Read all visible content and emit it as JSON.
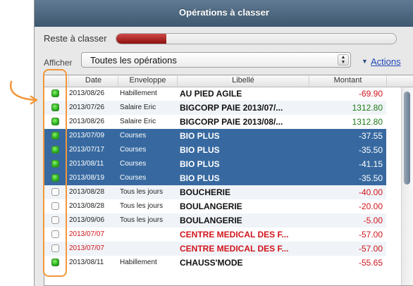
{
  "window": {
    "title": "Opérations à classer"
  },
  "toolbar": {
    "reste_label": "Reste à classer",
    "progress_fraction": 0.18,
    "afficher_label": "Afficher",
    "filter_value": "Toutes les opérations",
    "actions_label": "Actions"
  },
  "table": {
    "headers": {
      "date": "Date",
      "enveloppe": "Enveloppe",
      "libelle": "Libellé",
      "montant": "Montant"
    },
    "rows": [
      {
        "checked": true,
        "date": "2013/08/26",
        "enveloppe": "Habillement",
        "libelle": "AU PIED AGILE",
        "montant": "-69.90",
        "selected": false,
        "red": false
      },
      {
        "checked": true,
        "date": "2013/07/26",
        "enveloppe": "Salaire Eric",
        "libelle": "BIGCORP PAIE 2013/07/...",
        "montant": "1312.80",
        "selected": false,
        "red": false
      },
      {
        "checked": true,
        "date": "2013/08/26",
        "enveloppe": "Salaire Eric",
        "libelle": "BIGCORP PAIE 2013/08/...",
        "montant": "1312.80",
        "selected": false,
        "red": false
      },
      {
        "checked": true,
        "date": "2013/07/09",
        "enveloppe": "Courses",
        "libelle": "BIO PLUS",
        "montant": "-37.55",
        "selected": true,
        "red": false
      },
      {
        "checked": true,
        "date": "2013/07/17",
        "enveloppe": "Courses",
        "libelle": "BIO PLUS",
        "montant": "-35.50",
        "selected": true,
        "red": false
      },
      {
        "checked": true,
        "date": "2013/08/11",
        "enveloppe": "Courses",
        "libelle": "BIO PLUS",
        "montant": "-41.15",
        "selected": true,
        "red": false
      },
      {
        "checked": true,
        "date": "2013/08/19",
        "enveloppe": "Courses",
        "libelle": "BIO PLUS",
        "montant": "-35.50",
        "selected": true,
        "red": false
      },
      {
        "checked": false,
        "date": "2013/08/28",
        "enveloppe": "Tous les jours",
        "libelle": "BOUCHERIE",
        "montant": "-40.00",
        "selected": false,
        "red": false
      },
      {
        "checked": false,
        "date": "2013/08/28",
        "enveloppe": "Tous les jours",
        "libelle": "BOULANGERIE",
        "montant": "-20.00",
        "selected": false,
        "red": false
      },
      {
        "checked": false,
        "date": "2013/09/06",
        "enveloppe": "Tous les jours",
        "libelle": "BOULANGERIE",
        "montant": "-5.00",
        "selected": false,
        "red": false
      },
      {
        "checked": false,
        "date": "2013/07/07",
        "enveloppe": "",
        "libelle": "CENTRE MEDICAL DES F...",
        "montant": "-57.00",
        "selected": false,
        "red": true
      },
      {
        "checked": false,
        "date": "2013/07/07",
        "enveloppe": "",
        "libelle": "CENTRE MEDICAL DES F...",
        "montant": "-57.00",
        "selected": false,
        "red": true
      },
      {
        "checked": true,
        "date": "2013/08/11",
        "enveloppe": "Habillement",
        "libelle": "CHAUSS'MODE",
        "montant": "-55.65",
        "selected": false,
        "red": false
      }
    ]
  },
  "annotation": {
    "color": "#f2973a"
  }
}
